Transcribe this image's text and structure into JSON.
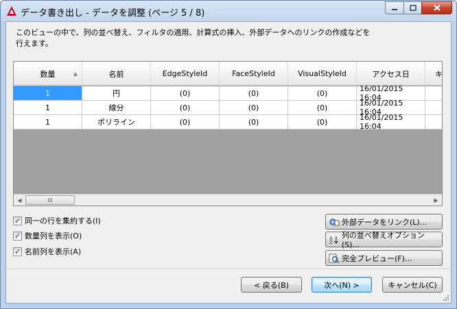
{
  "window": {
    "title": "データ書き出し - データを調整 (ページ 5 / 8)"
  },
  "description": "このビューの中で、列の並べ替え、フィルタの適用、計算式の挿入、外部データへのリンクの作成などを行えます。",
  "table": {
    "columns": [
      "数量",
      "名前",
      "EdgeStyleId",
      "FaceStyleId",
      "VisualStyleId",
      "アクセス日",
      "キ"
    ],
    "rows": [
      [
        "1",
        "円",
        "(0)",
        "(0)",
        "(0)",
        "16/01/2015 16:04"
      ],
      [
        "1",
        "線分",
        "(0)",
        "(0)",
        "(0)",
        "16/01/2015 16:04"
      ],
      [
        "1",
        "ポリライン",
        "(0)",
        "(0)",
        "(0)",
        "16/01/2015 16:04"
      ]
    ],
    "scroll_thumb_label": "III"
  },
  "options": {
    "combine_rows": "同一の行を集約する(I)",
    "show_count": "数量列を表示(O)",
    "show_name": "名前列を表示(A)"
  },
  "side_buttons": {
    "link_external": "外部データをリンク(L)...",
    "sort_options": "列の並べ替えオプション(S)...",
    "full_preview": "完全プレビュー(F)..."
  },
  "nav_buttons": {
    "back": "< 戻る(B)",
    "next": "次へ(N) >",
    "cancel": "キャンセル(C)"
  },
  "colors": {
    "selection": "#3399ff",
    "grid_empty": "#a0a0a0",
    "app_icon": "#c8102e"
  }
}
